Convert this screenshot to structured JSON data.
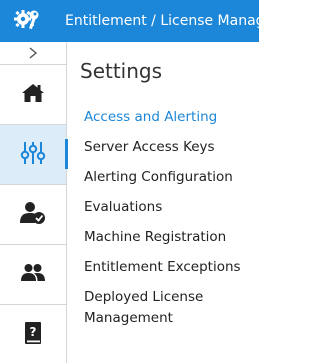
{
  "header": {
    "app_title": "Entitlement / License Manage"
  },
  "sidebar": {
    "collapse_glyph": "›",
    "items": [
      {
        "id": "home",
        "icon": "home-icon",
        "active": false
      },
      {
        "id": "settings",
        "icon": "sliders-icon",
        "active": true
      },
      {
        "id": "user-approval",
        "icon": "user-check-icon",
        "active": false
      },
      {
        "id": "groups",
        "icon": "users-icon",
        "active": false
      },
      {
        "id": "help",
        "icon": "help-book-icon",
        "active": false
      }
    ]
  },
  "main": {
    "title": "Settings",
    "menu": [
      {
        "label": "Access and Alerting",
        "active": true
      },
      {
        "label": "Server Access Keys",
        "active": false
      },
      {
        "label": "Alerting Configuration",
        "active": false
      },
      {
        "label": "Evaluations",
        "active": false
      },
      {
        "label": "Machine Registration",
        "active": false
      },
      {
        "label": "Entitlement Exceptions",
        "active": false
      },
      {
        "label": "Deployed License Management",
        "active": false
      }
    ]
  },
  "colors": {
    "accent": "#1c87d8",
    "active_nav_bg": "#dcecf8",
    "icon": "#222222"
  }
}
